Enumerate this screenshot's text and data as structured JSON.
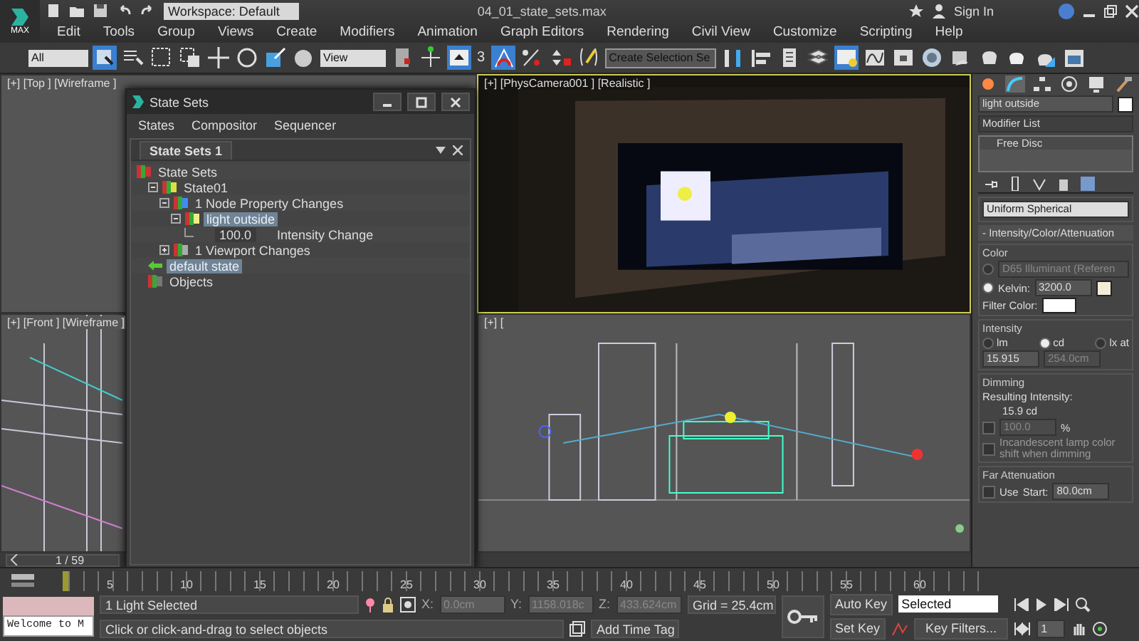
{
  "title_bar": {
    "app_button": "MAX",
    "workspace": "Workspace: Default",
    "filename": "04_01_state_sets.max",
    "sign_in": "Sign In"
  },
  "menu": [
    "Edit",
    "Tools",
    "Group",
    "Views",
    "Create",
    "Modifiers",
    "Animation",
    "Graph Editors",
    "Rendering",
    "Civil View",
    "Customize",
    "Scripting",
    "Help"
  ],
  "toolbar": {
    "selection_filter": "All",
    "reference_coord": "View",
    "snap_count": "3",
    "named_selection": "Create Selection Se"
  },
  "top_viewport": {
    "label": "[+] [Top ] [Wireframe ]"
  },
  "front_viewport": {
    "label": "[+] [Front ] [Wireframe ]"
  },
  "camera_viewport": {
    "label": "[+] [PhysCamera001 ] [Realistic ]"
  },
  "left_viewport": {
    "label": "[+] ["
  },
  "state_sets": {
    "title": "State Sets",
    "menu": [
      "States",
      "Compositor",
      "Sequencer"
    ],
    "tab": "State Sets 1",
    "tree": [
      {
        "kind": "root",
        "label": "State Sets",
        "selected": false,
        "children": [
          {
            "kind": "state",
            "label": "State01",
            "selected": false,
            "expanded": true,
            "children": [
              {
                "kind": "changes",
                "label": "1 Node Property Changes",
                "selected": false,
                "expanded": true,
                "children": [
                  {
                    "kind": "light",
                    "label": "light outside",
                    "selected": true,
                    "expanded": true,
                    "children": [
                      {
                        "kind": "property",
                        "value": "100.0",
                        "label": "Intensity Change",
                        "selected": false
                      }
                    ]
                  }
                ]
              },
              {
                "kind": "viewport",
                "label": "1 Viewport Changes",
                "selected": false,
                "expanded": false
              }
            ]
          },
          {
            "kind": "current",
            "label": "default state",
            "selected": true
          },
          {
            "kind": "objects",
            "label": "Objects",
            "selected": false
          }
        ]
      }
    ]
  },
  "command_panel": {
    "object_name": "light outside",
    "modifier_list": "Modifier List",
    "stack": [
      {
        "label": "Free Disc",
        "selected": false
      }
    ],
    "distribution": "Uniform Spherical",
    "rollout": "- Intensity/Color/Attenuation",
    "color_group": "Color",
    "preset": {
      "label": "D65 Illuminant (Referen",
      "selected": false,
      "disabled": true
    },
    "kelvin": {
      "label": "Kelvin:",
      "value": "3200.0",
      "selected": true
    },
    "filter_color": "Filter Color:",
    "intensity_group": "Intensity",
    "units": [
      {
        "label": "lm",
        "selected": false
      },
      {
        "label": "cd",
        "selected": true
      },
      {
        "label": "lx at",
        "selected": false
      }
    ],
    "intensity_value": "15.915",
    "distance": {
      "value": "254.0cm",
      "disabled": true
    },
    "dimming_group": "Dimming",
    "resulting_label": "Resulting Intensity:",
    "resulting_value": "15.9 cd",
    "dim_percent": {
      "value": "100.0",
      "unit": "%",
      "checked": false,
      "disabled": true
    },
    "incandescent": {
      "label": "Incandescent lamp color shift when dimming",
      "checked": false
    },
    "far_group": "Far Attenuation",
    "far_use": {
      "label": "Use",
      "checked": false
    },
    "start_label": "Start:",
    "start_value": "80.0cm"
  },
  "timeline": {
    "frame": "1 / 59",
    "level": 0,
    "ticks": [
      "5",
      "10",
      "15",
      "20",
      "25",
      "30",
      "35",
      "40",
      "45",
      "50",
      "55",
      "60"
    ]
  },
  "status_bar": {
    "listener": "Welcome to M",
    "selection": "1 Light Selected",
    "prompt": "Click or click-and-drag to select objects",
    "x_label": "X:",
    "x": "0.0cm",
    "y_label": "Y:",
    "y": "1158.018c",
    "z_label": "Z:",
    "z": "433.624cm",
    "grid": "Grid = 25.4cm",
    "add_time_tag": "Add Time Tag",
    "auto_key": "Auto Key",
    "key_mode": "Selected",
    "set_key": "Set Key",
    "key_filters": "Key Filters...",
    "current_frame": "1"
  }
}
